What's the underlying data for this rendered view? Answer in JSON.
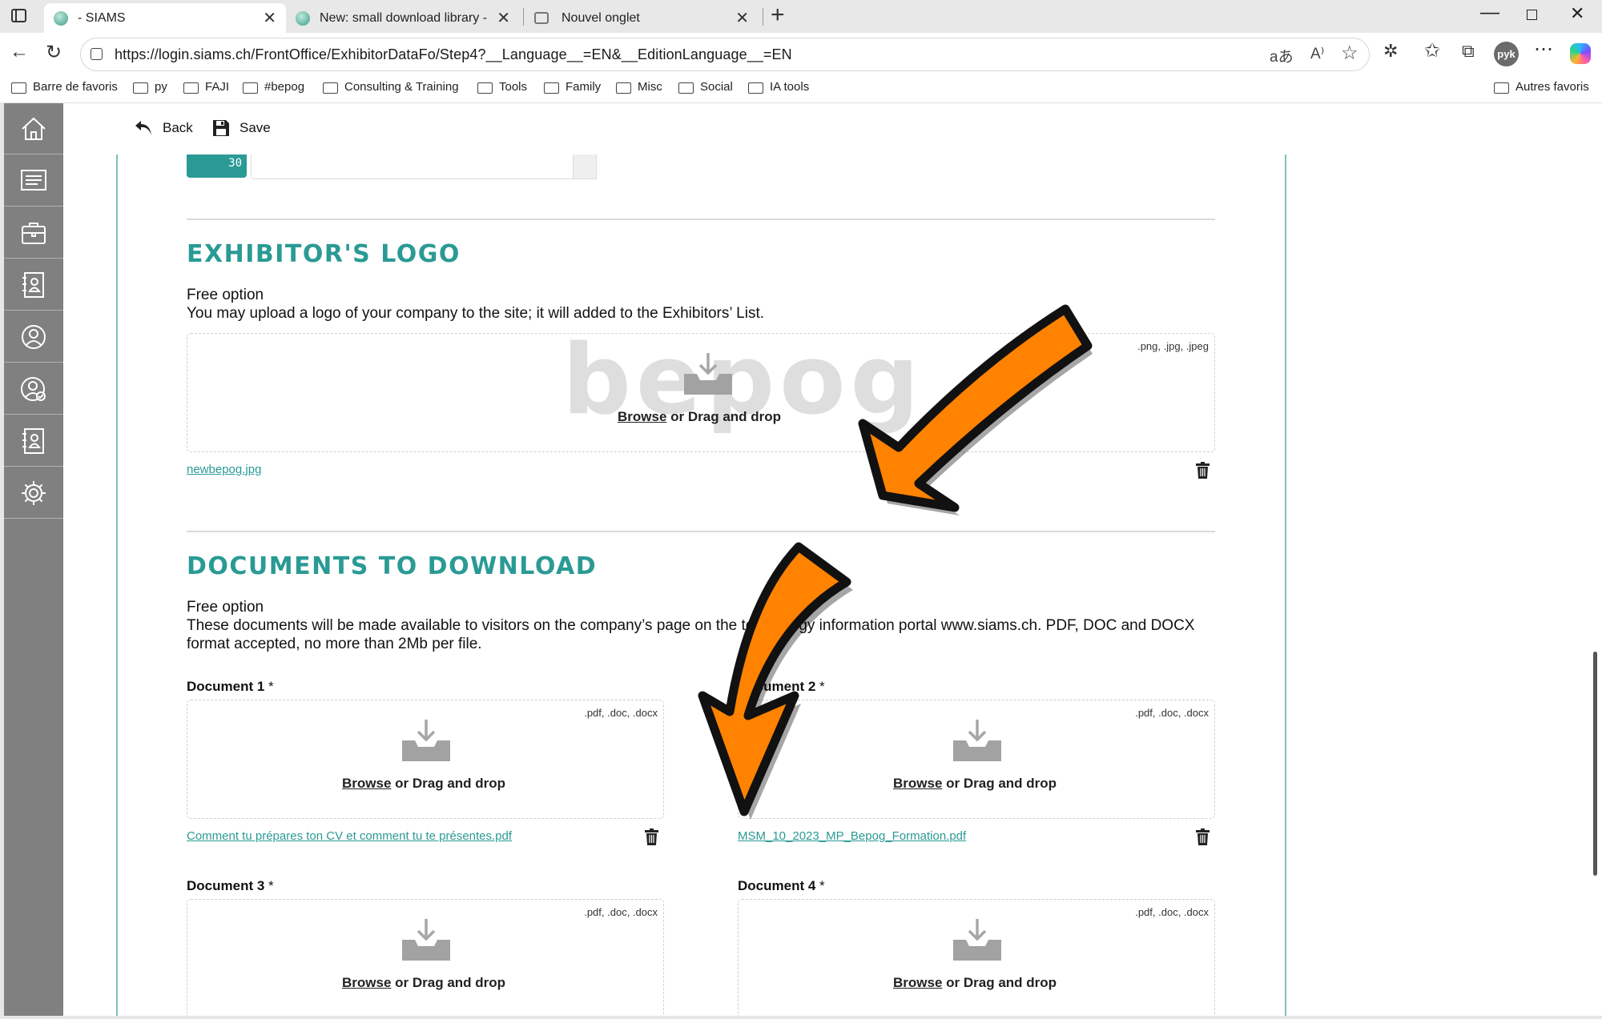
{
  "browser": {
    "tabs": [
      {
        "title": "- SIAMS",
        "active": true
      },
      {
        "title": "New: small download library - SIA",
        "active": false
      },
      {
        "title": "Nouvel onglet",
        "active": false
      }
    ],
    "url": "https://login.siams.ch/FrontOffice/ExhibitorDataFo/Step4?__Language__=EN&__EditionLanguage__=EN",
    "profile": "pyk",
    "bookmarks": [
      "Barre de favoris",
      "py",
      "FAJI",
      "#bepog",
      "Consulting & Training",
      "Tools",
      "Family",
      "Misc",
      "Social",
      "IA tools"
    ],
    "other_bookmarks": "Autres favoris"
  },
  "toolbar": {
    "back_label": "Back",
    "save_label": "Save"
  },
  "prev_field": {
    "counter": "30"
  },
  "logo_section": {
    "heading": "EXHIBITOR'S LOGO",
    "option": "Free option",
    "description": "You may upload a logo of your company to the site; it will added to the Exhibitors’ List.",
    "accepted": ".png, .jpg, .jpeg",
    "browse": "Browse",
    "or_drag": " or Drag and drop",
    "watermark": "bepog",
    "file": "newbepog.jpg"
  },
  "docs_section": {
    "heading": "DOCUMENTS TO DOWNLOAD",
    "option": "Free option",
    "description_line1": "These documents will be made available to visitors on the company’s page on the technology information portal www.siams.ch. PDF, DOC and DOCX",
    "description_line2": "format accepted, no more than 2Mb per file.",
    "accepted": ".pdf, .doc, .docx",
    "browse": "Browse",
    "or_drag": " or Drag and drop",
    "required_mark": "*",
    "documents": [
      {
        "label": "Document 1",
        "file": "Comment tu prépares ton CV et comment tu te présentes.pdf"
      },
      {
        "label": "Document 2",
        "file": "MSM_10_2023_MP_Bepog_Formation.pdf"
      },
      {
        "label": "Document 3",
        "file": ""
      },
      {
        "label": "Document 4",
        "file": ""
      }
    ]
  },
  "colors": {
    "accent": "#2a9a94",
    "annotation_arrow": "#ff8200",
    "sidebar": "#808080"
  }
}
